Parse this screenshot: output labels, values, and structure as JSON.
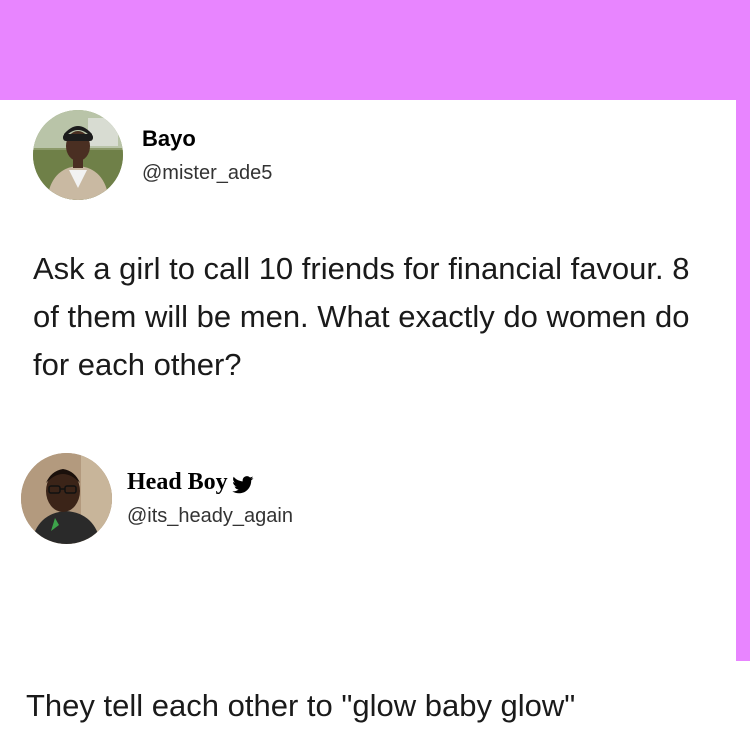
{
  "colors": {
    "background_band": "#e885ff",
    "card": "#ffffff",
    "text": "#1a1a1a"
  },
  "tweets": [
    {
      "display_name": "Bayo",
      "handle": "@mister_ade5",
      "text": "Ask a girl to call 10 friends for financial favour. 8 of them will be men. What exactly do women do for each other?"
    },
    {
      "display_name": "Head Boy",
      "handle": "@its_heady_again",
      "badge_icon": "twitter-bird-icon",
      "text": "They tell  each other to \"glow baby glow\""
    }
  ]
}
